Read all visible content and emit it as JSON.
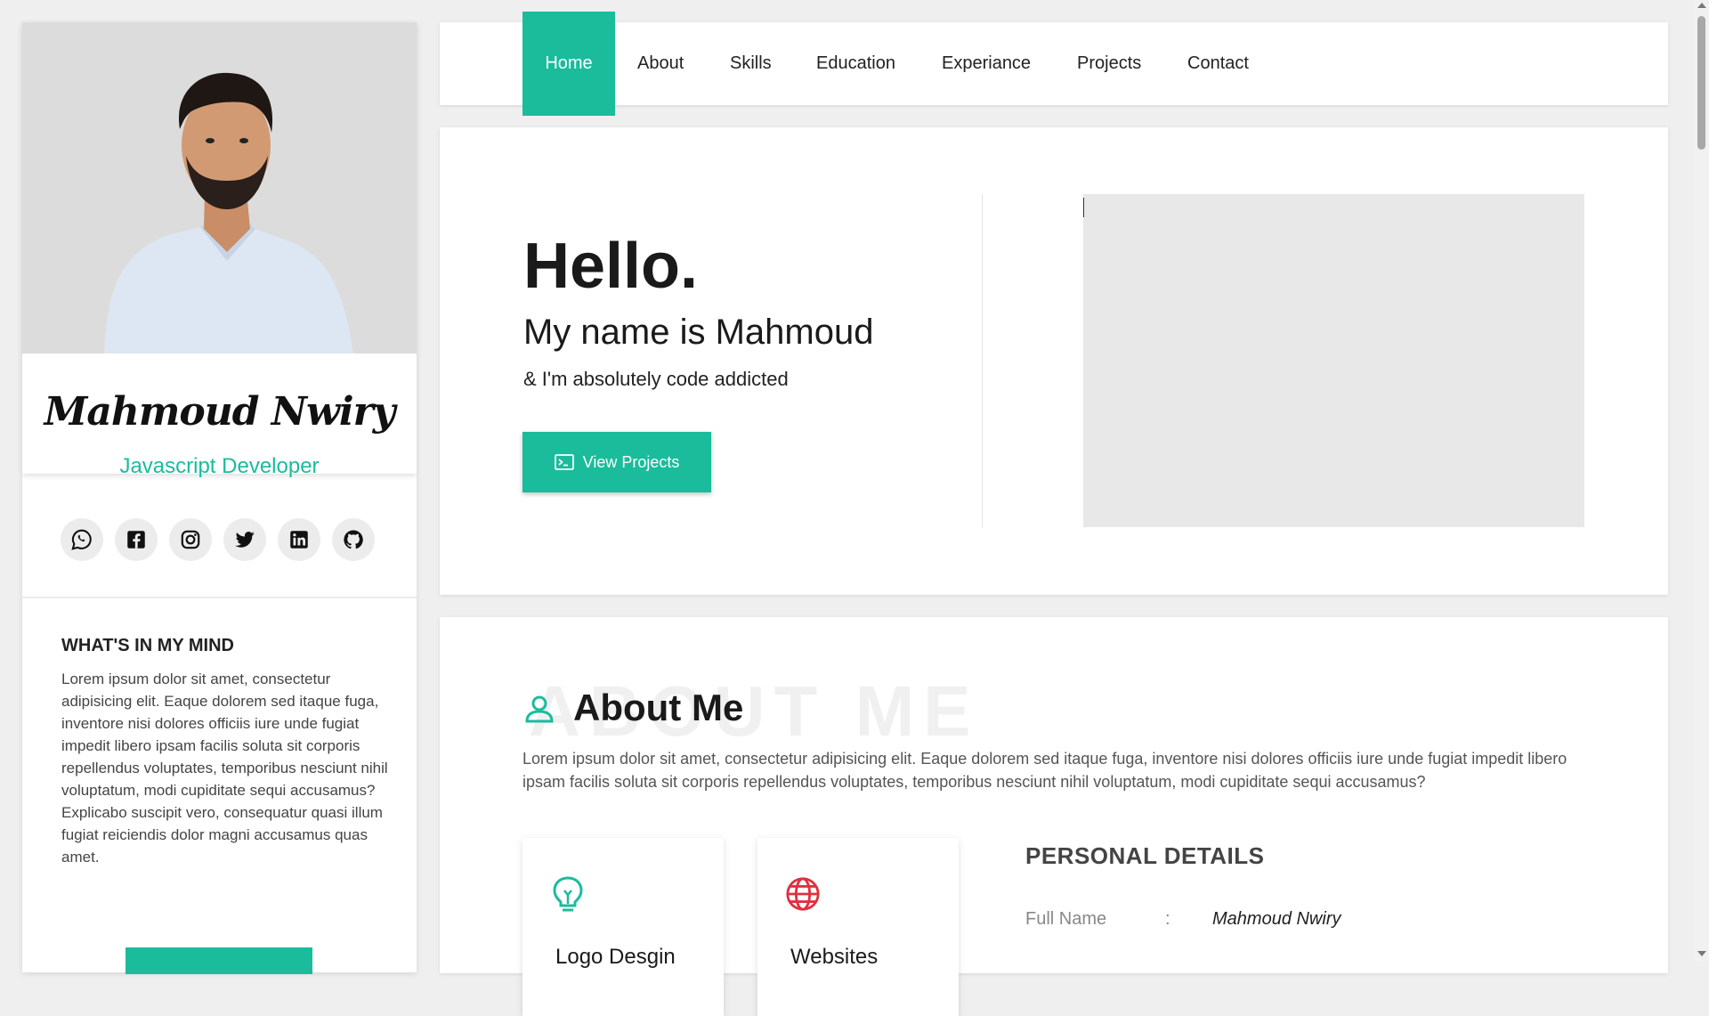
{
  "profile": {
    "name": "Mahmoud Nwiry",
    "role": "Javascript Developer"
  },
  "socials": [
    {
      "icon": "whatsapp-icon"
    },
    {
      "icon": "facebook-icon"
    },
    {
      "icon": "instagram-icon"
    },
    {
      "icon": "twitter-icon"
    },
    {
      "icon": "linkedin-icon"
    },
    {
      "icon": "github-icon"
    }
  ],
  "sidebar": {
    "mind_title": "WHAT'S IN MY MIND",
    "mind_text": "Lorem ipsum dolor sit amet, consectetur adipisicing elit. Eaque dolorem sed itaque fuga, inventore nisi dolores officiis iure unde fugiat impedit libero ipsam facilis soluta sit corporis repellendus voluptates, temporibus nesciunt nihil voluptatum, modi cupiditate sequi accusamus? Explicabo suscipit vero, consequatur quasi illum fugiat reiciendis dolor magni accusamus quas amet."
  },
  "nav": {
    "items": [
      "Home",
      "About",
      "Skills",
      "Education",
      "Experiance",
      "Projects",
      "Contact"
    ],
    "active": "Home"
  },
  "hero": {
    "hello": "Hello.",
    "name_line": "My name is Mahmoud",
    "tagline": "& I'm absolutely code addicted",
    "button": "View Projects"
  },
  "about": {
    "ghost": "ABOUT ME",
    "title": "About Me",
    "text": "Lorem ipsum dolor sit amet, consectetur adipisicing elit. Eaque dolorem sed itaque fuga, inventore nisi dolores officiis iure unde fugiat impedit libero ipsam facilis soluta sit corporis repellendus voluptates, temporibus nesciunt nihil voluptatum, modi cupiditate sequi accusamus?",
    "services": [
      {
        "title": "Logo Desgin",
        "icon": "lightbulb-icon"
      },
      {
        "title": "Websites",
        "icon": "globe-icon"
      }
    ],
    "personal": {
      "title": "PERSONAL DETAILS",
      "rows": [
        {
          "label": "Full Name",
          "sep": ":",
          "value": "Mahmoud Nwiry"
        }
      ]
    }
  },
  "colors": {
    "accent": "#1abc9c",
    "globe": "#e0303f",
    "background": "#efefef"
  }
}
